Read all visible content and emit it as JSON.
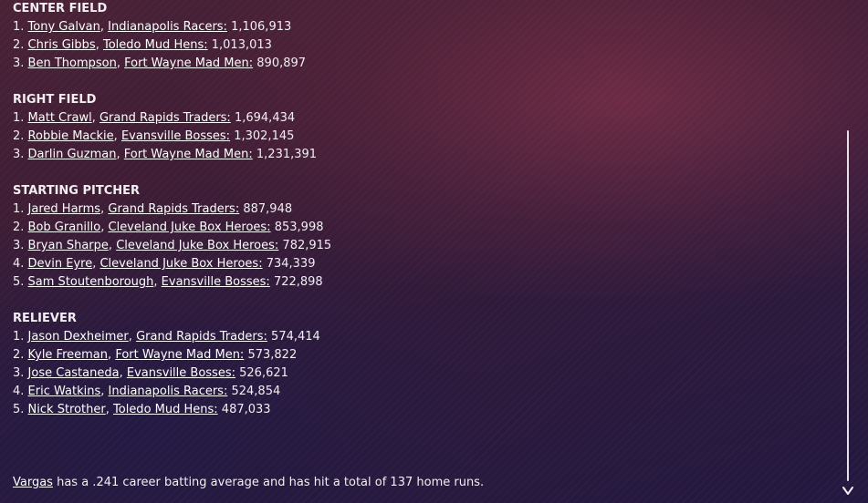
{
  "sections": [
    {
      "title": "CENTER FIELD",
      "items": [
        {
          "rank": "1.",
          "player": "Tony Galvan",
          "team": "Indianapolis Racers:",
          "votes": "1,106,913"
        },
        {
          "rank": "2.",
          "player": "Chris Gibbs",
          "team": "Toledo  Mud Hens:",
          "votes": "1,013,013"
        },
        {
          "rank": "3.",
          "player": "Ben Thompson",
          "team": "Fort Wayne Mad Men:",
          "votes": "890,897"
        }
      ]
    },
    {
      "title": "RIGHT FIELD",
      "items": [
        {
          "rank": "1.",
          "player": "Matt Crawl",
          "team": "Grand Rapids Traders:",
          "votes": "1,694,434"
        },
        {
          "rank": "2.",
          "player": "Robbie Mackie",
          "team": "Evansville Bosses:",
          "votes": "1,302,145"
        },
        {
          "rank": "3.",
          "player": "Darlin Guzman",
          "team": "Fort Wayne Mad Men:",
          "votes": "1,231,391"
        }
      ]
    },
    {
      "title": "STARTING PITCHER",
      "items": [
        {
          "rank": "1.",
          "player": "Jared Harms",
          "team": "Grand Rapids Traders:",
          "votes": "887,948"
        },
        {
          "rank": "2.",
          "player": "Bob Granillo",
          "team": "Cleveland Juke Box Heroes:",
          "votes": "853,998"
        },
        {
          "rank": "3.",
          "player": "Bryan Sharpe",
          "team": "Cleveland Juke Box Heroes:",
          "votes": "782,915"
        },
        {
          "rank": "4.",
          "player": "Devin Eyre",
          "team": "Cleveland Juke Box Heroes:",
          "votes": "734,339"
        },
        {
          "rank": "5.",
          "player": "Sam Stoutenborough",
          "team": "Evansville Bosses:",
          "votes": "722,898"
        }
      ]
    },
    {
      "title": "RELIEVER",
      "items": [
        {
          "rank": "1.",
          "player": "Jason Dexheimer",
          "team": "Grand Rapids Traders:",
          "votes": "574,414"
        },
        {
          "rank": "2.",
          "player": "Kyle Freeman",
          "team": "Fort Wayne Mad Men:",
          "votes": "573,822"
        },
        {
          "rank": "3.",
          "player": "Jose Castaneda",
          "team": "Evansville Bosses:",
          "votes": "526,621"
        },
        {
          "rank": "4.",
          "player": "Eric Watkins",
          "team": "Indianapolis Racers:",
          "votes": "524,854"
        },
        {
          "rank": "5.",
          "player": "Nick Strother",
          "team": "Toledo  Mud Hens:",
          "votes": "487,033"
        }
      ]
    }
  ],
  "footer": {
    "player_link": "Vargas",
    "text": " has a .241 career batting average and has hit a total of 137 home runs."
  },
  "scrollbar": {
    "down_icon": "chevron-down-icon"
  }
}
